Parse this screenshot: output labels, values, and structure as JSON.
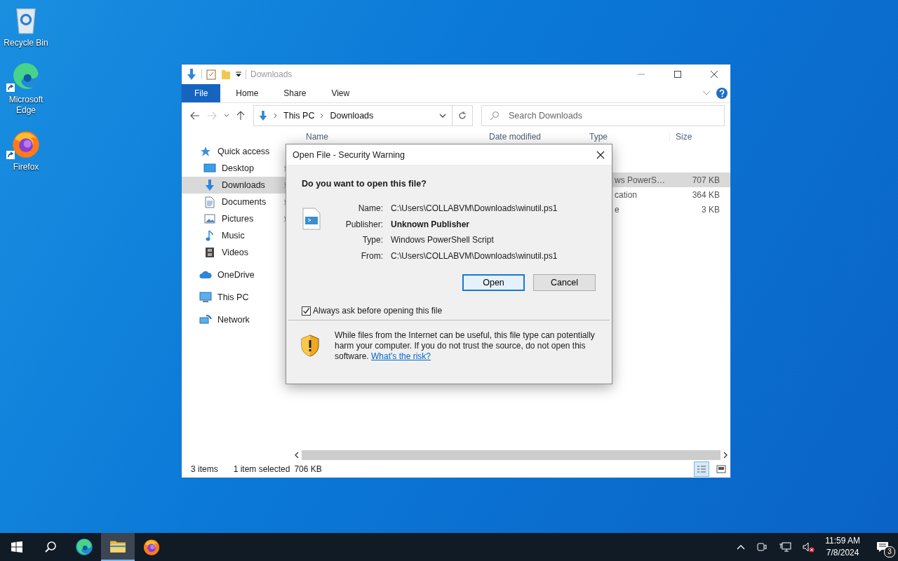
{
  "desktop_icons": [
    {
      "label": "Recycle Bin",
      "kind": "recycle",
      "shortcut": false
    },
    {
      "label": "Microsoft Edge",
      "kind": "edge",
      "shortcut": true
    },
    {
      "label": "Firefox",
      "kind": "firefox",
      "shortcut": true
    }
  ],
  "explorer": {
    "title": "Downloads",
    "ribbon_tabs": [
      {
        "label": "File",
        "kind": "file"
      },
      {
        "label": "Home",
        "kind": "tab"
      },
      {
        "label": "Share",
        "kind": "tab"
      },
      {
        "label": "View",
        "kind": "tab"
      }
    ],
    "breadcrumb": [
      "This PC",
      "Downloads"
    ],
    "search": {
      "placeholder": "Search Downloads"
    },
    "sidebar": [
      {
        "label": "Quick access",
        "kind": "star",
        "selected": false,
        "children": [
          {
            "label": "Desktop",
            "kind": "desktop",
            "selected": false,
            "pinned": true
          },
          {
            "label": "Downloads",
            "kind": "download",
            "selected": true,
            "pinned": true
          },
          {
            "label": "Documents",
            "kind": "document",
            "selected": false,
            "pinned": true
          },
          {
            "label": "Pictures",
            "kind": "pictures",
            "selected": false,
            "pinned": true
          },
          {
            "label": "Music",
            "kind": "music",
            "selected": false,
            "pinned": false
          },
          {
            "label": "Videos",
            "kind": "videos",
            "selected": false,
            "pinned": false
          }
        ]
      },
      {
        "label": "OneDrive",
        "kind": "cloud",
        "selected": false
      },
      {
        "label": "This PC",
        "kind": "pc",
        "selected": false
      },
      {
        "label": "Network",
        "kind": "network",
        "selected": false
      }
    ],
    "columns": [
      "Name",
      "Date modified",
      "Type",
      "Size"
    ],
    "rows": [
      {
        "type": "ws PowerS…",
        "size": "707 KB",
        "selected": true
      },
      {
        "type": "cation",
        "size": "364 KB",
        "selected": false
      },
      {
        "type": "e",
        "size": "3 KB",
        "selected": false
      }
    ],
    "status": {
      "count": "3 items",
      "selection": "1 item selected",
      "size": "706 KB"
    },
    "views": [
      {
        "kind": "details",
        "selected": true
      },
      {
        "kind": "large",
        "selected": false
      }
    ]
  },
  "dialog": {
    "title": "Open File - Security Warning",
    "question": "Do you want to open this file?",
    "fields": [
      {
        "label": "Name:",
        "value": "C:\\Users\\COLLABVM\\Downloads\\winutil.ps1",
        "bold": false
      },
      {
        "label": "Publisher:",
        "value": "Unknown Publisher",
        "bold": true
      },
      {
        "label": "Type:",
        "value": "Windows PowerShell Script",
        "bold": false
      },
      {
        "label": "From:",
        "value": "C:\\Users\\COLLABVM\\Downloads\\winutil.ps1",
        "bold": false
      }
    ],
    "buttons": [
      {
        "label": "Open",
        "default": true
      },
      {
        "label": "Cancel",
        "default": false
      }
    ],
    "checkbox": {
      "label": "Always ask before opening this file",
      "checked": true
    },
    "warning": "While files from the Internet can be useful, this file type can potentially harm your computer. If you do not trust the source, do not open this software.",
    "link": "What's the risk?"
  },
  "taskbar": {
    "apps": [
      {
        "kind": "search",
        "active": false
      },
      {
        "kind": "edge",
        "active": false
      },
      {
        "kind": "explorer",
        "active": true
      },
      {
        "kind": "firefox",
        "active": false
      }
    ],
    "time": "11:59 AM",
    "date": "7/8/2024",
    "notifications": "3"
  }
}
